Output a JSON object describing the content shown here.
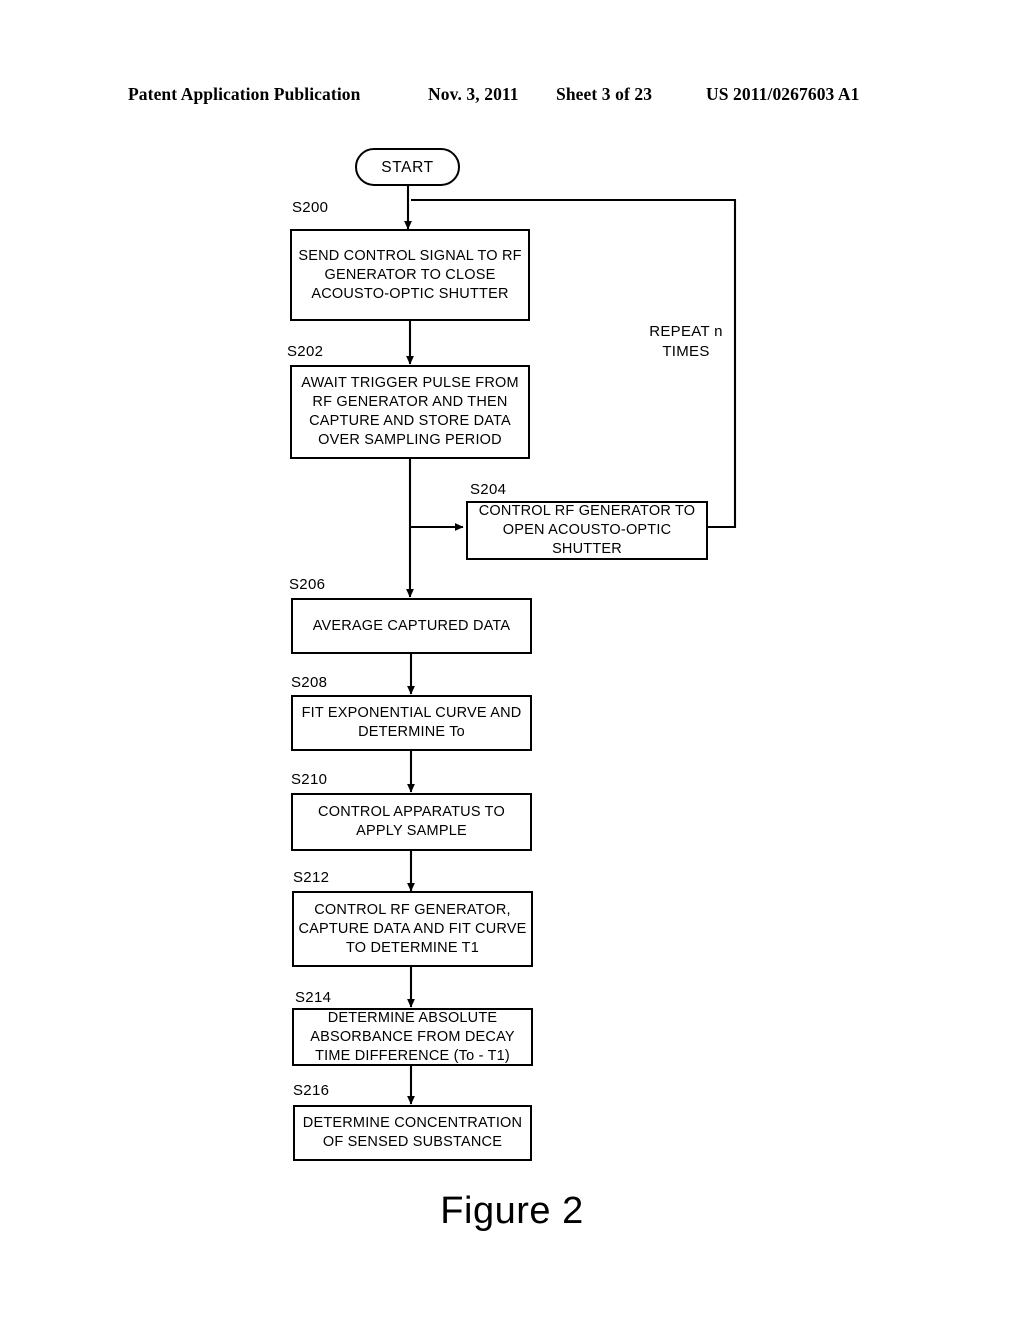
{
  "header": {
    "publication": "Patent Application Publication",
    "date": "Nov. 3, 2011",
    "sheet": "Sheet 3 of 23",
    "number": "US 2011/0267603 A1"
  },
  "figure": {
    "caption": "Figure 2"
  },
  "flowchart": {
    "start_label": "START",
    "loop_annotation": "REPEAT n\nTIMES",
    "steps": [
      {
        "id": "S200",
        "text": "SEND CONTROL SIGNAL TO RF GENERATOR TO CLOSE ACOUSTO-OPTIC SHUTTER"
      },
      {
        "id": "S202",
        "text": "AWAIT TRIGGER PULSE FROM RF GENERATOR AND THEN CAPTURE AND STORE DATA OVER SAMPLING PERIOD"
      },
      {
        "id": "S204",
        "text": "CONTROL RF GENERATOR TO OPEN ACOUSTO-OPTIC SHUTTER"
      },
      {
        "id": "S206",
        "text": "AVERAGE CAPTURED DATA"
      },
      {
        "id": "S208",
        "text": "FIT EXPONENTIAL CURVE AND DETERMINE To"
      },
      {
        "id": "S210",
        "text": "CONTROL APPARATUS TO APPLY SAMPLE"
      },
      {
        "id": "S212",
        "text": "CONTROL RF GENERATOR, CAPTURE DATA AND FIT CURVE TO DETERMINE T1"
      },
      {
        "id": "S214",
        "text": "DETERMINE ABSOLUTE ABSORBANCE FROM DECAY TIME DIFFERENCE (To - T1)"
      },
      {
        "id": "S216",
        "text": "DETERMINE CONCENTRATION OF SENSED SUBSTANCE"
      }
    ]
  },
  "colors": {
    "ink": "#000000",
    "paper": "#ffffff"
  }
}
